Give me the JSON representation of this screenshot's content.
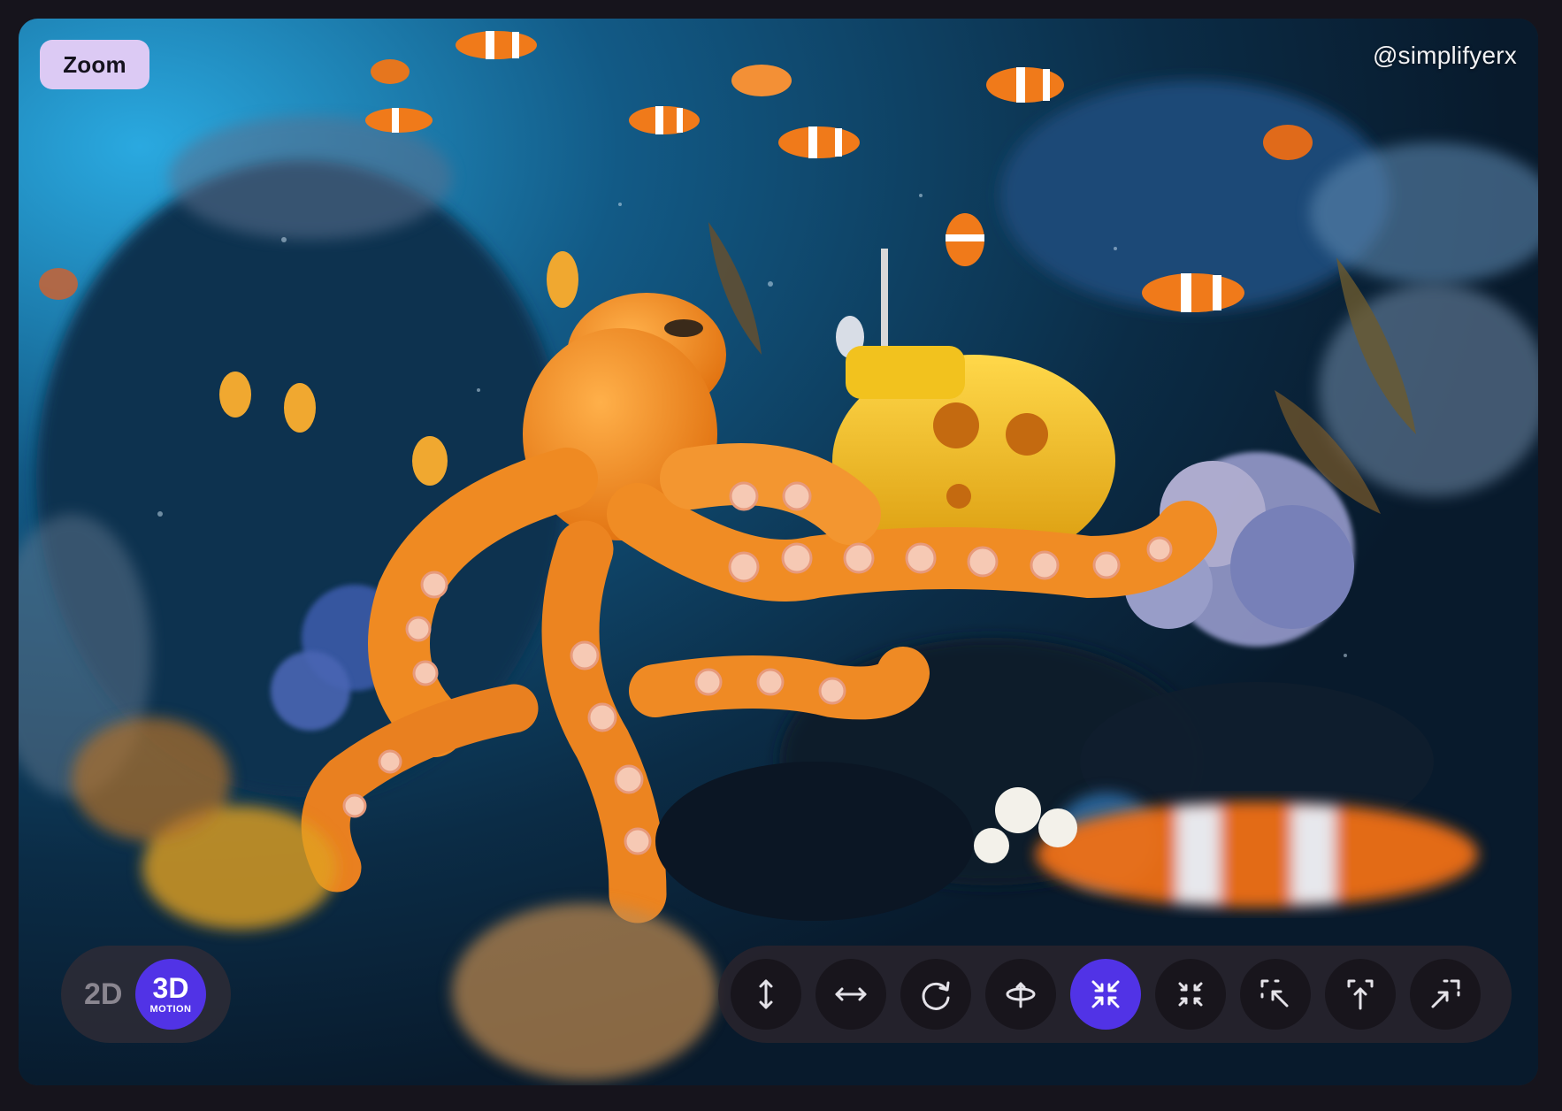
{
  "overlay": {
    "zoom_label": "Zoom",
    "handle": "@simplifyerx"
  },
  "mode_toggle": {
    "option_2d": "2D",
    "option_3d": "3D",
    "option_3d_sub": "MOTION",
    "selected": "3D"
  },
  "toolbar": {
    "buttons": [
      {
        "icon": "vertical-arrows-icon",
        "active": false
      },
      {
        "icon": "horizontal-arrows-icon",
        "active": false
      },
      {
        "icon": "rotate-icon",
        "active": false
      },
      {
        "icon": "orbit-icon",
        "active": false
      },
      {
        "icon": "zoom-in-arrows-icon",
        "active": true
      },
      {
        "icon": "zoom-out-arrows-icon",
        "active": false
      },
      {
        "icon": "corner-zoom-icon",
        "active": false
      },
      {
        "icon": "dolly-up-icon",
        "active": false
      },
      {
        "icon": "expand-diagonal-icon",
        "active": false
      }
    ]
  },
  "colors": {
    "accent": "#5133e6",
    "badge_bg": "#dccaf4",
    "page_bg": "#16141c"
  }
}
